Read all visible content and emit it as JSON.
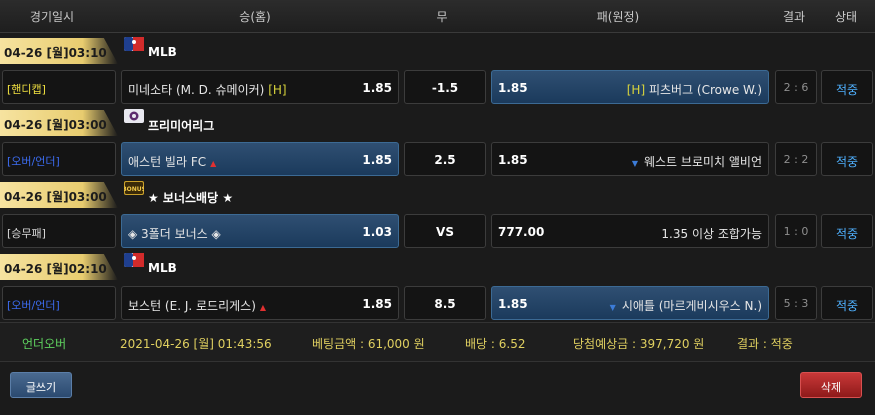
{
  "header": {
    "date_col": "경기일시",
    "home_col": "승(홈)",
    "draw_col": "무",
    "away_col": "패(원정)",
    "result_col": "결과",
    "status_col": "상태"
  },
  "groups": [
    {
      "date": "04-26 [월]03:10",
      "league": "MLB",
      "league_icon": "mlb-icon",
      "bet_type": "[핸디캡]",
      "bet_type_color": "#f0e040",
      "home_team": "미네소타 (M. D. 슈메이커)",
      "home_tag": "[H]",
      "home_odds": "1.85",
      "mid": "-1.5",
      "away_odds": "1.85",
      "away_tag": "[H]",
      "away_team": "피츠버그 (Crowe W.)",
      "score": "2 : 6",
      "status": "적중"
    },
    {
      "date": "04-26 [월]03:00",
      "league": "프리미어리그",
      "league_icon": "premier-league-icon",
      "bet_type": "[오버/언더]",
      "bet_type_color": "#3c6cf0",
      "home_team": "애스턴 빌라 FC",
      "home_odds": "1.85",
      "mid": "2.5",
      "away_odds": "1.85",
      "away_team": "웨스트 브로미치 앨비언",
      "score": "2 : 2",
      "status": "적중"
    },
    {
      "date": "04-26 [월]03:00",
      "league": "★ 보너스배당 ★",
      "league_icon": "bonus-icon",
      "bet_type": "[승무패]",
      "bet_type_color": "#d8d8d8",
      "home_team": "◈ 3폴더 보너스 ◈",
      "home_odds": "1.03",
      "mid": "VS",
      "away_odds": "777.00",
      "away_team": "1.35 이상 조합가능",
      "score": "1 : 0",
      "status": "적중"
    },
    {
      "date": "04-26 [월]02:10",
      "league": "MLB",
      "league_icon": "mlb-icon",
      "bet_type": "[오버/언더]",
      "bet_type_color": "#3c6cf0",
      "home_team": "보스턴 (E. J. 로드리게스)",
      "home_odds": "1.85",
      "mid": "8.5",
      "away_odds": "1.85",
      "away_team": "시애틀 (마르게비시우스 N.)",
      "score": "5 : 3",
      "status": "적중"
    }
  ],
  "summary": {
    "type": "언더오버",
    "datetime": "2021-04-26 [월] 01:43:56",
    "bet_amount": "베팅금액 : 61,000 원",
    "odds": "배당 : 6.52",
    "expected": "당첨예상금 : 397,720 원",
    "result": "결과 : 적중"
  },
  "buttons": {
    "write": "글쓰기",
    "delete": "삭제"
  },
  "colors": {
    "accent_blue": "#4fb1ff",
    "summary_green": "#5fd35f",
    "summary_yellow": "#e0d060",
    "date_gold": "#e8cc6f"
  }
}
